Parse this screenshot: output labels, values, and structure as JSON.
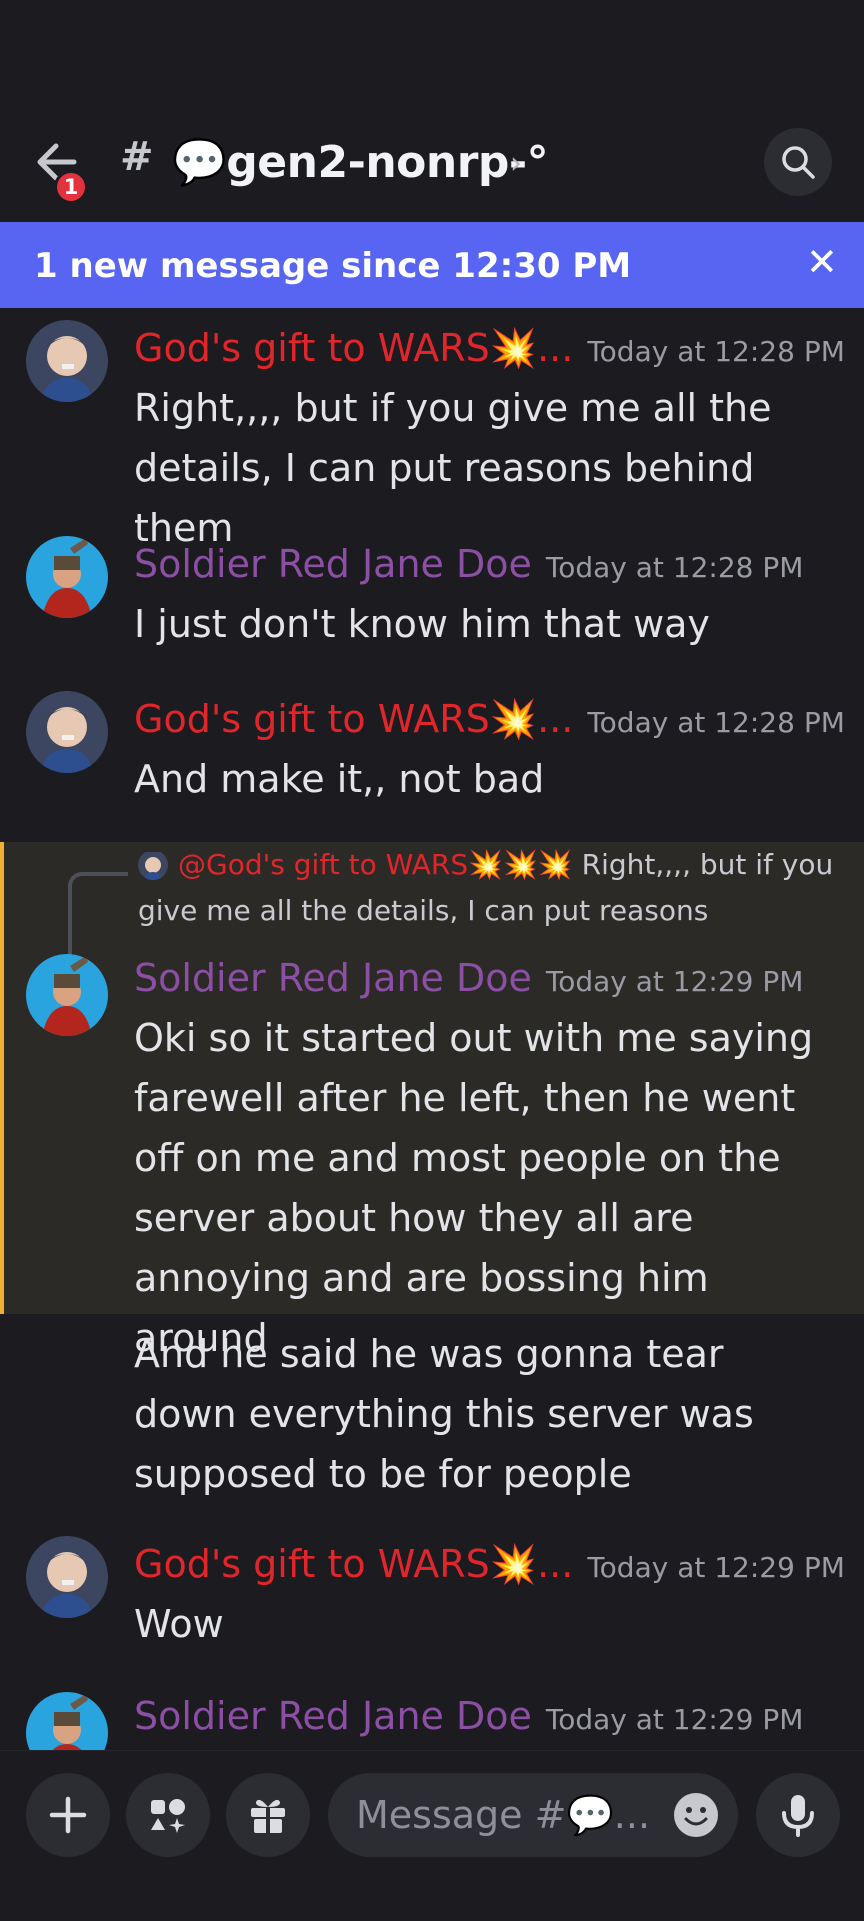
{
  "header": {
    "badge_count": "1",
    "hash": "#",
    "channel_name": "💬gen2-nonrp-°",
    "chevron": "›"
  },
  "banner": {
    "text": "1 new message since 12:30 PM",
    "close": "✕"
  },
  "messages": [
    {
      "username": "God's gift to WARS💥...",
      "timestamp": "Today at 12:28 PM",
      "text": "Right,,,, but if you give me all the details, I can put reasons behind them"
    },
    {
      "username": "Soldier Red Jane Doe",
      "timestamp": "Today at 12:28 PM",
      "text": "I just don't know him that way"
    },
    {
      "username": "God's gift to WARS💥...",
      "timestamp": "Today at 12:28 PM",
      "text": "And make it,, not bad"
    },
    {
      "reply_mention": "@God's gift to WARS💥💥💥",
      "reply_preview": " Right,,,, but if you give me all the details, I can put reasons",
      "username": "Soldier Red Jane Doe",
      "timestamp": "Today at 12:29 PM",
      "text": "Oki so it started out with me saying farewell after he left, then he went off on me and most people on the server about how they all are annoying and are bossing him around"
    },
    {
      "text": "And he said he was gonna tear down everything this server was supposed to be for people"
    },
    {
      "username": "God's gift to WARS💥...",
      "timestamp": "Today at 12:29 PM",
      "text": "Wow"
    },
    {
      "username": "Soldier Red Jane Doe",
      "timestamp": "Today at 12:29 PM"
    }
  ],
  "composer": {
    "placeholder": "Message #💬..."
  },
  "colors": {
    "background": "#1b1b20",
    "banner": "#5865f2",
    "username_red": "#e0262b",
    "username_purple": "#8b4fa3",
    "highlight_bar": "#f0b132"
  }
}
